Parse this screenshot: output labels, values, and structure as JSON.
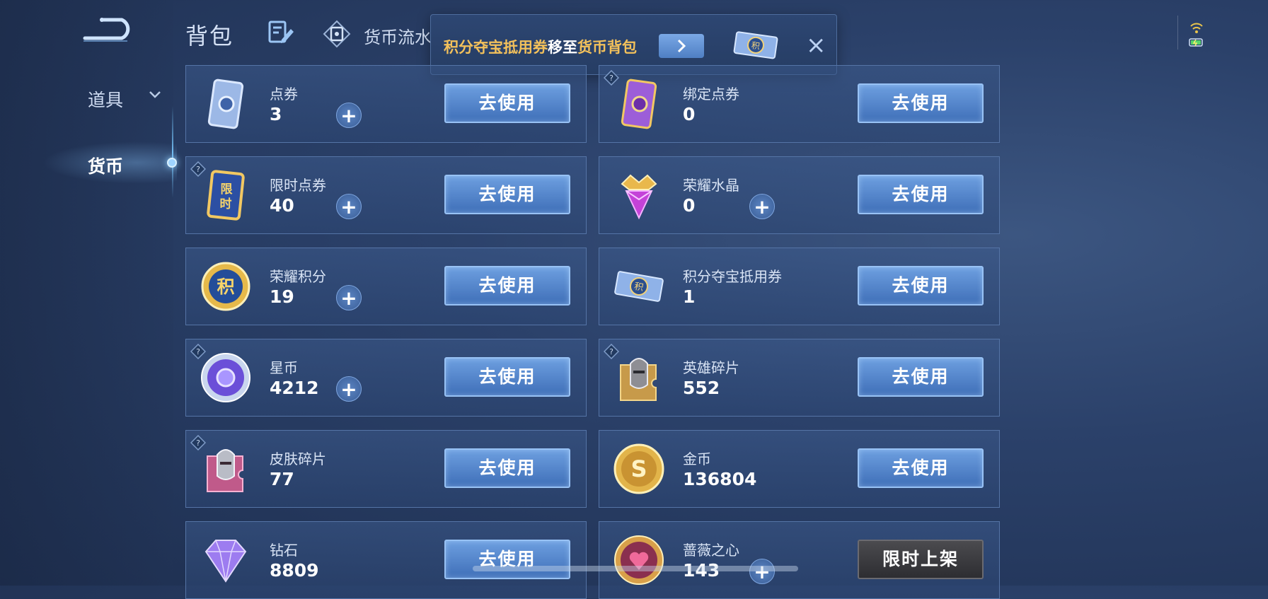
{
  "sidebar": {
    "items": [
      {
        "label": "道具",
        "active": false
      },
      {
        "label": "货币",
        "active": true
      }
    ]
  },
  "header": {
    "title": "背包",
    "flow_label": "货币流水"
  },
  "toast": {
    "part1": "积分夺宝抵用券",
    "part2": "移至",
    "part3": "货币背包",
    "highlight_color": "#f3c15b"
  },
  "cards": [
    {
      "name": "点券",
      "value": "3",
      "button": "去使用",
      "plus": true,
      "icon": "blue-card-icon"
    },
    {
      "name": "绑定点券",
      "value": "0",
      "button": "去使用",
      "plus": false,
      "icon": "purple-card-icon"
    },
    {
      "name": "限时点券",
      "value": "40",
      "button": "去使用",
      "plus": true,
      "icon": "limited-time-card-icon"
    },
    {
      "name": "荣耀水晶",
      "value": "0",
      "button": "去使用",
      "plus": true,
      "icon": "crystal-icon"
    },
    {
      "name": "荣耀积分",
      "value": "19",
      "button": "去使用",
      "plus": true,
      "icon": "points-coin-icon"
    },
    {
      "name": "积分夺宝抵用券",
      "value": "1",
      "button": "去使用",
      "plus": false,
      "icon": "voucher-ticket-icon"
    },
    {
      "name": "星币",
      "value": "4212",
      "button": "去使用",
      "plus": true,
      "icon": "star-coin-icon"
    },
    {
      "name": "英雄碎片",
      "value": "552",
      "button": "去使用",
      "plus": false,
      "icon": "hero-fragment-icon"
    },
    {
      "name": "皮肤碎片",
      "value": "77",
      "button": "去使用",
      "plus": false,
      "icon": "skin-fragment-icon"
    },
    {
      "name": "金币",
      "value": "136804",
      "button": "去使用",
      "plus": false,
      "icon": "gold-coin-icon"
    },
    {
      "name": "钻石",
      "value": "8809",
      "button": "去使用",
      "plus": false,
      "icon": "diamond-icon"
    },
    {
      "name": "蔷薇之心",
      "value": "143",
      "button": "限时上架",
      "plus": true,
      "icon": "rose-heart-icon"
    }
  ],
  "plus_symbol": "+",
  "toast_close_symbol": "×",
  "accent_color": "#4f7fc4"
}
